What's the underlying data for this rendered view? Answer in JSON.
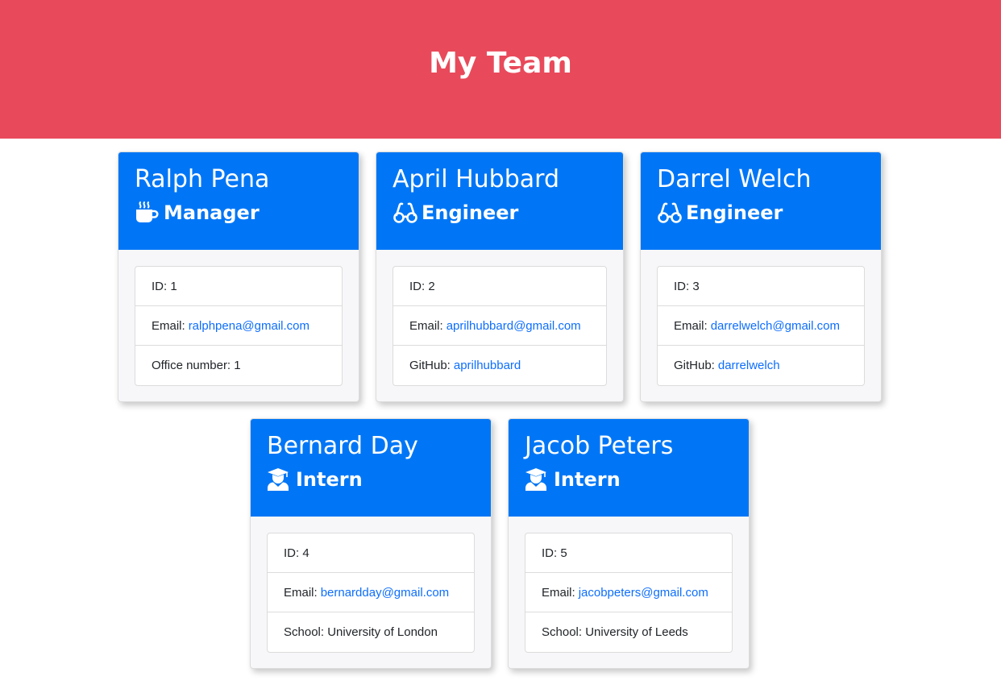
{
  "header": {
    "title": "My Team"
  },
  "cards": [
    {
      "name": "Ralph Pena",
      "role": "Manager",
      "icon": "mug-hot-icon",
      "id_label": "ID:",
      "id": "1",
      "email_label": "Email:",
      "email": "ralphpena@gmail.com",
      "extra_label": "Office number:",
      "extra": "1"
    },
    {
      "name": "April Hubbard",
      "role": "Engineer",
      "icon": "glasses-icon",
      "id_label": "ID:",
      "id": "2",
      "email_label": "Email:",
      "email": "aprilhubbard@gmail.com",
      "extra_label": "GitHub:",
      "extra": "aprilhubbard"
    },
    {
      "name": "Darrel Welch",
      "role": "Engineer",
      "icon": "glasses-icon",
      "id_label": "ID:",
      "id": "3",
      "email_label": "Email:",
      "email": "darrelwelch@gmail.com",
      "extra_label": "GitHub:",
      "extra": "darrelwelch"
    },
    {
      "name": "Bernard Day",
      "role": "Intern",
      "icon": "graduate-icon",
      "id_label": "ID:",
      "id": "4",
      "email_label": "Email:",
      "email": "bernardday@gmail.com",
      "extra_label": "School:",
      "extra": "University of London"
    },
    {
      "name": "Jacob Peters",
      "role": "Intern",
      "icon": "graduate-icon",
      "id_label": "ID:",
      "id": "5",
      "email_label": "Email:",
      "email": "jacobpeters@gmail.com",
      "extra_label": "School:",
      "extra": "University of Leeds"
    }
  ],
  "colors": {
    "header_bg": "#e84a5b",
    "card_header_bg": "#0076f6",
    "link": "#0d6efd"
  }
}
